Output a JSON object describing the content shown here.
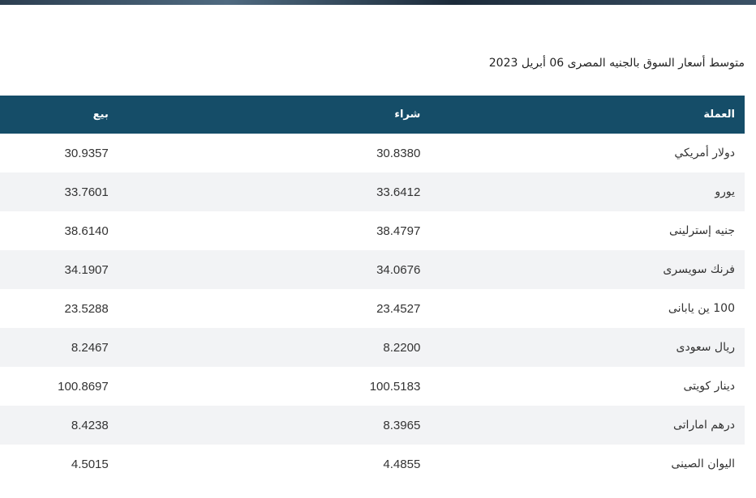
{
  "caption": "متوسط أسعار السوق بالجنيه المصرى 06 أبريل 2023",
  "table": {
    "headers": {
      "currency": "العملة",
      "buy": "شراء",
      "sell": "بيع"
    },
    "rows": [
      {
        "currency": "دولار أمريكي",
        "buy": "30.8380",
        "sell": "30.9357"
      },
      {
        "currency": "يورو",
        "buy": "33.6412",
        "sell": "33.7601"
      },
      {
        "currency": "جنيه إسترلينى",
        "buy": "38.4797",
        "sell": "38.6140"
      },
      {
        "currency": "فرنك سويسرى",
        "buy": "34.0676",
        "sell": "34.1907"
      },
      {
        "currency": "100 ين يابانى",
        "buy": "23.4527",
        "sell": "23.5288"
      },
      {
        "currency": "ريال سعودى",
        "buy": "8.2200",
        "sell": "8.2467"
      },
      {
        "currency": "دينار كويتى",
        "buy": "100.5183",
        "sell": "100.8697"
      },
      {
        "currency": "درهم اماراتى",
        "buy": "8.3965",
        "sell": "8.4238"
      },
      {
        "currency": "اليوان الصينى",
        "buy": "4.4855",
        "sell": "4.5015"
      }
    ]
  }
}
